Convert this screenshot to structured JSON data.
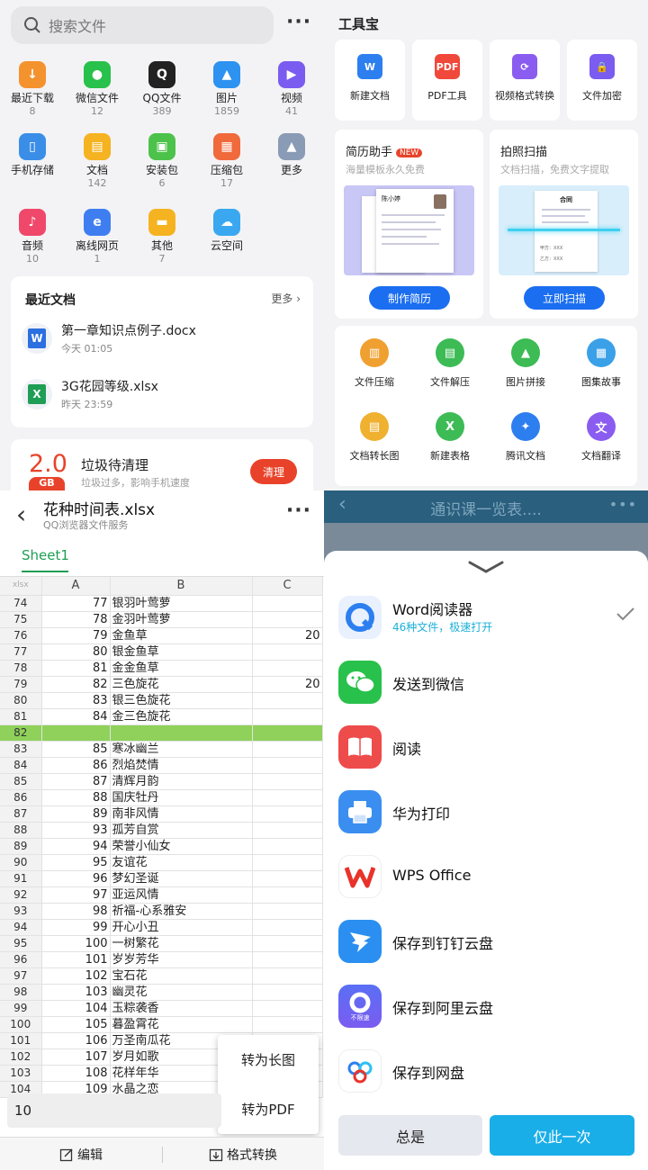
{
  "file_manager": {
    "search_placeholder": "搜索文件",
    "categories": [
      {
        "label": "最近下载",
        "count": "8",
        "color": "#f4922e",
        "glyph": "↓"
      },
      {
        "label": "微信文件",
        "count": "12",
        "color": "#27c14b",
        "glyph": "●"
      },
      {
        "label": "QQ文件",
        "count": "389",
        "color": "#222222",
        "glyph": "Q"
      },
      {
        "label": "图片",
        "count": "1859",
        "color": "#2d92f0",
        "glyph": "▲"
      },
      {
        "label": "视频",
        "count": "41",
        "color": "#7a5cf0",
        "glyph": "▶"
      },
      {
        "label": "手机存储",
        "count": "",
        "color": "#3b8ee8",
        "glyph": "▯"
      },
      {
        "label": "文档",
        "count": "142",
        "color": "#f5b321",
        "glyph": "▤"
      },
      {
        "label": "安装包",
        "count": "6",
        "color": "#4cc24a",
        "glyph": "▣"
      },
      {
        "label": "压缩包",
        "count": "17",
        "color": "#f06a3c",
        "glyph": "▦"
      },
      {
        "label": "更多",
        "count": "",
        "color": "#8a9bb5",
        "glyph": "▲"
      },
      {
        "label": "音频",
        "count": "10",
        "color": "#f0486a",
        "glyph": "♪"
      },
      {
        "label": "离线网页",
        "count": "1",
        "color": "#3f7ef0",
        "glyph": "e"
      },
      {
        "label": "其他",
        "count": "7",
        "color": "#f5b321",
        "glyph": "▬"
      },
      {
        "label": "云空间",
        "count": "",
        "color": "#3aa8f0",
        "glyph": "☁"
      }
    ],
    "recent": {
      "title": "最近文档",
      "more": "更多",
      "docs": [
        {
          "name": "第一章知识点例子.docx",
          "time": "今天 01:05",
          "type": "W",
          "color": "#2b6fe0"
        },
        {
          "name": "3G花园等级.xlsx",
          "time": "昨天 23:59",
          "type": "X",
          "color": "#1f9e55"
        }
      ]
    },
    "cleanup": {
      "amount": "2.0",
      "unit": "GB",
      "title": "垃圾待清理",
      "desc": "垃圾过多，影响手机速度",
      "button": "清理"
    }
  },
  "toolbox": {
    "title": "工具宝",
    "tools": [
      {
        "label": "新建文档",
        "color": "#2d7ff0",
        "glyph": "W"
      },
      {
        "label": "PDF工具",
        "color": "#f0483a",
        "glyph": "PDF"
      },
      {
        "label": "视频格式转换",
        "color": "#8a5cf0",
        "glyph": "⟳"
      },
      {
        "label": "文件加密",
        "color": "#7a5cf0",
        "glyph": "🔒"
      }
    ],
    "promos": [
      {
        "title": "简历助手",
        "badge": "NEW",
        "subtitle": "海量模板永久免费",
        "button": "制作简历"
      },
      {
        "title": "拍照扫描",
        "badge": "",
        "subtitle": "文档扫描，免费文字提取",
        "button": "立即扫描"
      }
    ],
    "grid": [
      {
        "label": "文件压缩",
        "color": "#f0a030",
        "glyph": "▥"
      },
      {
        "label": "文件解压",
        "color": "#3dbb55",
        "glyph": "▤"
      },
      {
        "label": "图片拼接",
        "color": "#3dbb55",
        "glyph": "▲"
      },
      {
        "label": "图集故事",
        "color": "#3aa0e8",
        "glyph": "▦"
      },
      {
        "label": "文档转长图",
        "color": "#f0b030",
        "glyph": "▤"
      },
      {
        "label": "新建表格",
        "color": "#3dbb55",
        "glyph": "X"
      },
      {
        "label": "腾讯文档",
        "color": "#2d7ff0",
        "glyph": "✦"
      },
      {
        "label": "文档翻译",
        "color": "#8a5cf0",
        "glyph": "文"
      }
    ],
    "resume_preview_name": "陈小婷",
    "contract_preview": {
      "title": "合同",
      "party_a": "甲方：XXX",
      "party_b": "乙方：XXX"
    }
  },
  "spreadsheet": {
    "file_name": "花种时间表.xlsx",
    "service": "QQ浏览器文件服务",
    "sheet_tab": "Sheet1",
    "corner": "xlsx",
    "columns": [
      "A",
      "B",
      "C"
    ],
    "rows": [
      {
        "r": "74",
        "a": "77",
        "b": "银羽叶莺萝",
        "c": ""
      },
      {
        "r": "75",
        "a": "78",
        "b": "金羽叶莺萝",
        "c": ""
      },
      {
        "r": "76",
        "a": "79",
        "b": "金鱼草",
        "c": "20"
      },
      {
        "r": "77",
        "a": "80",
        "b": "银金鱼草",
        "c": ""
      },
      {
        "r": "78",
        "a": "81",
        "b": "金金鱼草",
        "c": ""
      },
      {
        "r": "79",
        "a": "82",
        "b": "三色旋花",
        "c": "20"
      },
      {
        "r": "80",
        "a": "83",
        "b": "银三色旋花",
        "c": ""
      },
      {
        "r": "81",
        "a": "84",
        "b": "金三色旋花",
        "c": ""
      },
      {
        "r": "82",
        "a": "",
        "b": "",
        "c": "",
        "hl": true
      },
      {
        "r": "83",
        "a": "85",
        "b": "寒冰幽兰",
        "c": ""
      },
      {
        "r": "84",
        "a": "86",
        "b": "烈焰焚情",
        "c": ""
      },
      {
        "r": "85",
        "a": "87",
        "b": "清辉月韵",
        "c": ""
      },
      {
        "r": "86",
        "a": "88",
        "b": "国庆牡丹",
        "c": ""
      },
      {
        "r": "87",
        "a": "89",
        "b": "南非风情",
        "c": ""
      },
      {
        "r": "88",
        "a": "93",
        "b": "孤芳自赏",
        "c": ""
      },
      {
        "r": "89",
        "a": "94",
        "b": "荣誉小仙女",
        "c": ""
      },
      {
        "r": "90",
        "a": "95",
        "b": "友谊花",
        "c": ""
      },
      {
        "r": "91",
        "a": "96",
        "b": "梦幻圣诞",
        "c": ""
      },
      {
        "r": "92",
        "a": "97",
        "b": "亚运风情",
        "c": ""
      },
      {
        "r": "93",
        "a": "98",
        "b": "祈福-心系雅安",
        "c": ""
      },
      {
        "r": "94",
        "a": "99",
        "b": "开心小丑",
        "c": ""
      },
      {
        "r": "95",
        "a": "100",
        "b": "一树繁花",
        "c": ""
      },
      {
        "r": "96",
        "a": "101",
        "b": "岁岁芳华",
        "c": ""
      },
      {
        "r": "97",
        "a": "102",
        "b": "宝石花",
        "c": ""
      },
      {
        "r": "98",
        "a": "103",
        "b": "幽灵花",
        "c": ""
      },
      {
        "r": "99",
        "a": "104",
        "b": "玉粽袭香",
        "c": ""
      },
      {
        "r": "100",
        "a": "105",
        "b": "暮盈霄花",
        "c": ""
      },
      {
        "r": "101",
        "a": "106",
        "b": "万圣南瓜花",
        "c": ""
      },
      {
        "r": "102",
        "a": "107",
        "b": "岁月如歌",
        "c": ""
      },
      {
        "r": "103",
        "a": "108",
        "b": "花样年华",
        "c": ""
      },
      {
        "r": "104",
        "a": "109",
        "b": "水晶之恋",
        "c": ""
      }
    ],
    "popup": [
      "转为长图",
      "转为PDF"
    ],
    "input_value": "10",
    "edit_label": "编辑",
    "convert_label": "格式转换"
  },
  "open_with": {
    "header_title": "通识课一览表....",
    "apps": [
      {
        "name": "Word阅读器",
        "sub": "46种文件，极速打开",
        "checked": true
      },
      {
        "name": "发送到微信",
        "sub": ""
      },
      {
        "name": "阅读",
        "sub": ""
      },
      {
        "name": "华为打印",
        "sub": ""
      },
      {
        "name": "WPS Office",
        "sub": ""
      },
      {
        "name": "保存到钉钉云盘",
        "sub": ""
      },
      {
        "name": "保存到阿里云盘",
        "sub": "",
        "icon_text": "不限速"
      },
      {
        "name": "保存到网盘",
        "sub": ""
      }
    ],
    "always": "总是",
    "once": "仅此一次"
  }
}
